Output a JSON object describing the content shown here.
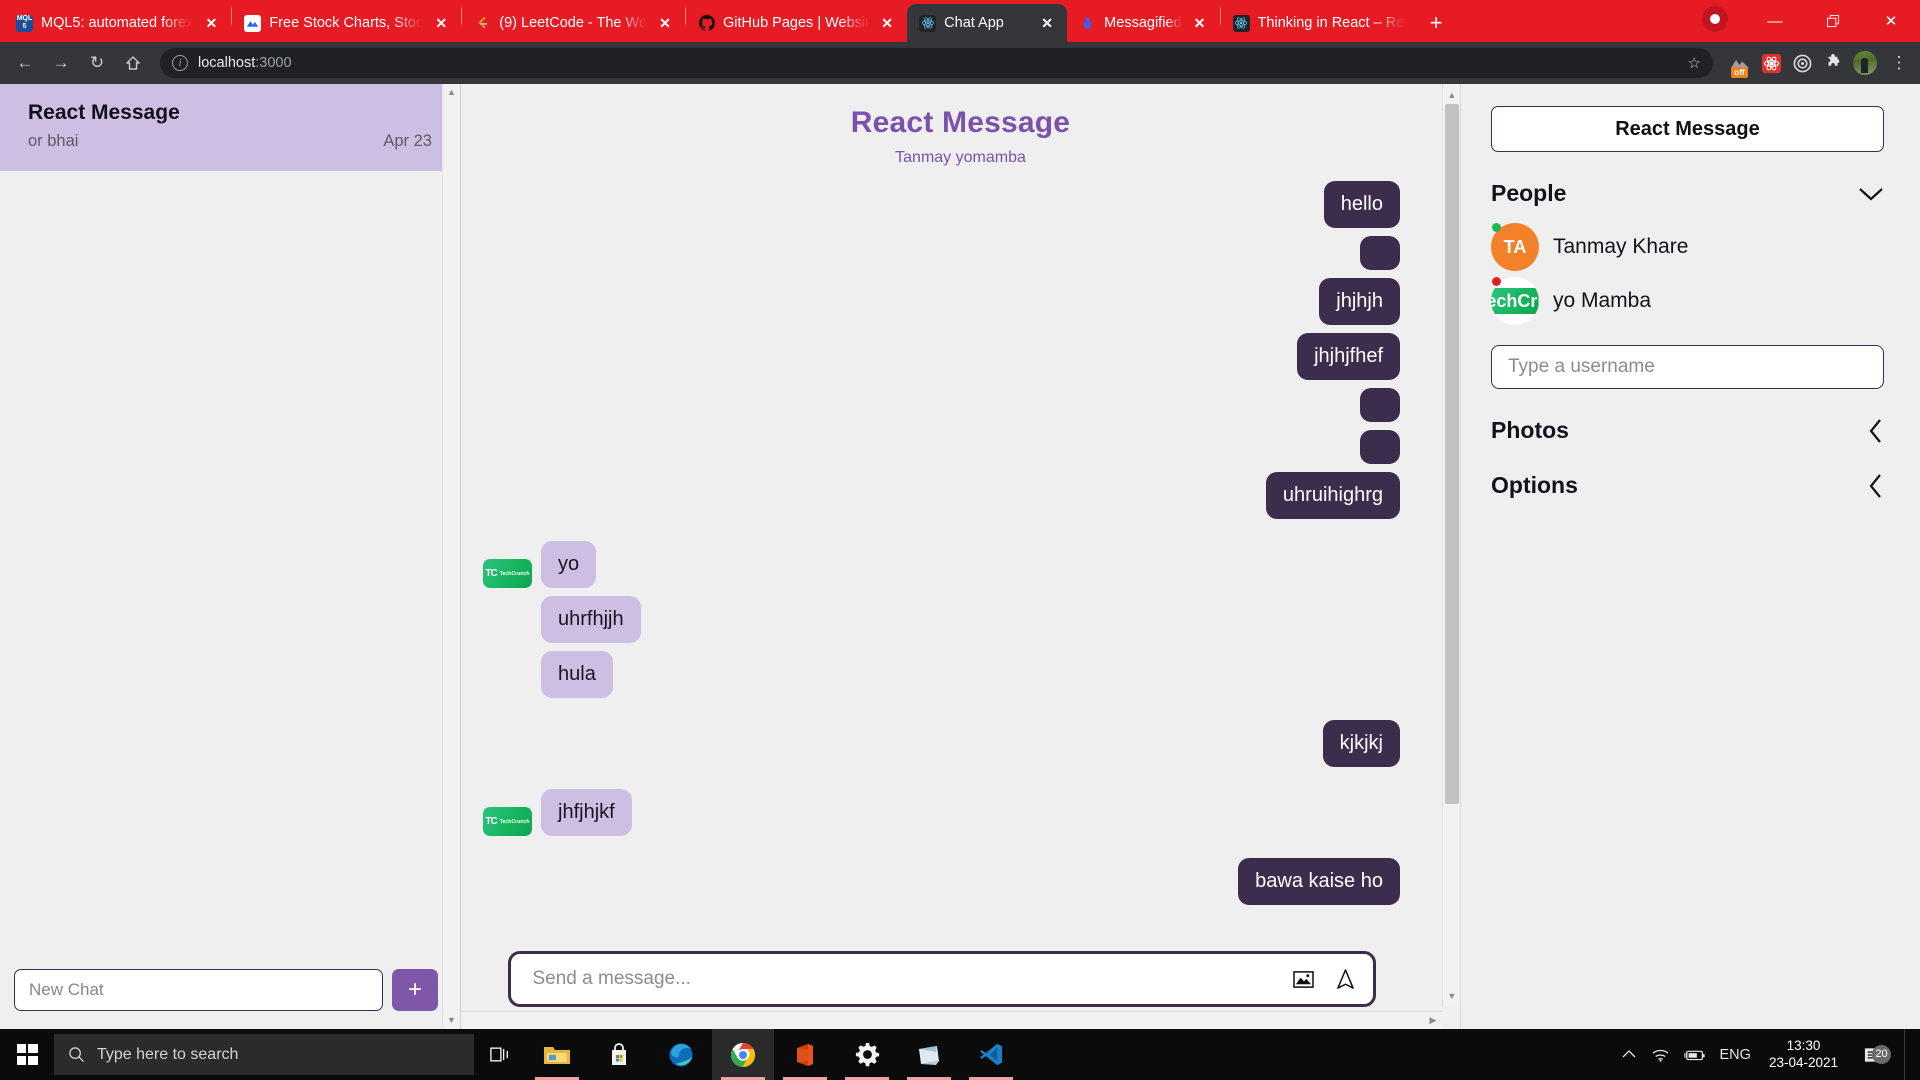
{
  "browser": {
    "tabs": [
      {
        "title": "MQL5: automated forex",
        "favicon": "mql5-icon",
        "active": false
      },
      {
        "title": "Free Stock Charts, Stoc",
        "favicon": "tradingview-icon",
        "active": false
      },
      {
        "title": "(9) LeetCode - The Wo",
        "favicon": "leetcode-icon",
        "active": false
      },
      {
        "title": "GitHub Pages | Websit",
        "favicon": "github-icon",
        "active": false
      },
      {
        "title": "Chat App",
        "favicon": "react-icon",
        "active": true
      },
      {
        "title": "Messagified",
        "favicon": "messagified-icon",
        "active": false
      },
      {
        "title": "Thinking in React – Re",
        "favicon": "react-icon",
        "active": false
      }
    ],
    "new_tab_label": "+",
    "window_controls": {
      "minimize": "—",
      "maximize": "❐",
      "close": "✕"
    },
    "toolbar": {
      "back": "←",
      "forward": "→",
      "reload": "↻",
      "home": "⌂",
      "url_host": "localhost",
      "url_port": ":3000",
      "bookmark_star": "☆",
      "extension_badge": "off",
      "menu": "⋮"
    }
  },
  "sidebar": {
    "chats": [
      {
        "name": "React Message",
        "last_message": "or bhai",
        "date": "Apr 23",
        "selected": true
      }
    ],
    "new_chat_placeholder": "New Chat",
    "new_chat_value": "",
    "add_button_label": "+"
  },
  "chat": {
    "title": "React Message",
    "subtitle": "Tanmay yomamba",
    "messages": [
      {
        "side": "sent",
        "text": "hello",
        "avatar": false
      },
      {
        "side": "sent",
        "text": "",
        "avatar": false
      },
      {
        "side": "sent",
        "text": "jhjhjh",
        "avatar": false
      },
      {
        "side": "sent",
        "text": "jhjhjfhef",
        "avatar": false
      },
      {
        "side": "sent",
        "text": "",
        "avatar": false
      },
      {
        "side": "sent",
        "text": "",
        "avatar": false
      },
      {
        "side": "sent",
        "text": "uhruihighrg",
        "avatar": false
      },
      {
        "side": "recv",
        "text": "yo",
        "avatar": true,
        "avatar_label": "TechCrunch"
      },
      {
        "side": "recv",
        "text": "uhrfhjjh",
        "avatar": false
      },
      {
        "side": "recv",
        "text": "hula",
        "avatar": false
      },
      {
        "side": "sent",
        "text": "kjkjkj",
        "avatar": false
      },
      {
        "side": "recv",
        "text": "jhfjhjkf",
        "avatar": true,
        "avatar_label": "TechCrunch"
      },
      {
        "side": "sent",
        "text": "bawa kaise ho",
        "avatar": false
      }
    ],
    "composer": {
      "placeholder": "Send a message...",
      "value": "",
      "image_icon": "image-icon",
      "send_icon": "send-icon"
    }
  },
  "right_panel": {
    "room_title": "React Message",
    "sections": [
      {
        "label": "People",
        "chevron": "∨",
        "expanded": true
      },
      {
        "label": "Photos",
        "chevron": "‹",
        "expanded": false
      },
      {
        "label": "Options",
        "chevron": "‹",
        "expanded": false
      }
    ],
    "people": [
      {
        "name": "Tanmay Khare",
        "initials": "TA",
        "status": "online",
        "avatar_type": "initials"
      },
      {
        "name": "yo Mamba",
        "initials": "",
        "status": "offline",
        "avatar_type": "techcrunch"
      }
    ],
    "username_placeholder": "Type a username",
    "username_value": ""
  },
  "taskbar": {
    "search_placeholder": "Type here to search",
    "apps": [
      {
        "name": "file-explorer",
        "running": true
      },
      {
        "name": "microsoft-store",
        "running": false
      },
      {
        "name": "microsoft-edge",
        "running": false
      },
      {
        "name": "google-chrome",
        "running": true,
        "active": true
      },
      {
        "name": "microsoft-office",
        "running": true
      },
      {
        "name": "settings",
        "running": true
      },
      {
        "name": "sticky-notes",
        "running": true
      },
      {
        "name": "visual-studio-code",
        "running": true
      }
    ],
    "tray": {
      "chevron": "⌃",
      "language": "ENG",
      "time": "13:30",
      "date": "23-04-2021",
      "notification_count": "20"
    }
  },
  "colors": {
    "tab_bar_red": "#e71b23",
    "bubble_sent": "#3c2d4d",
    "bubble_recv": "#cdbfe3",
    "accent_purple": "#7b52ab",
    "sidebar_selected": "#cdbfe3",
    "page_bg": "#efefef"
  }
}
